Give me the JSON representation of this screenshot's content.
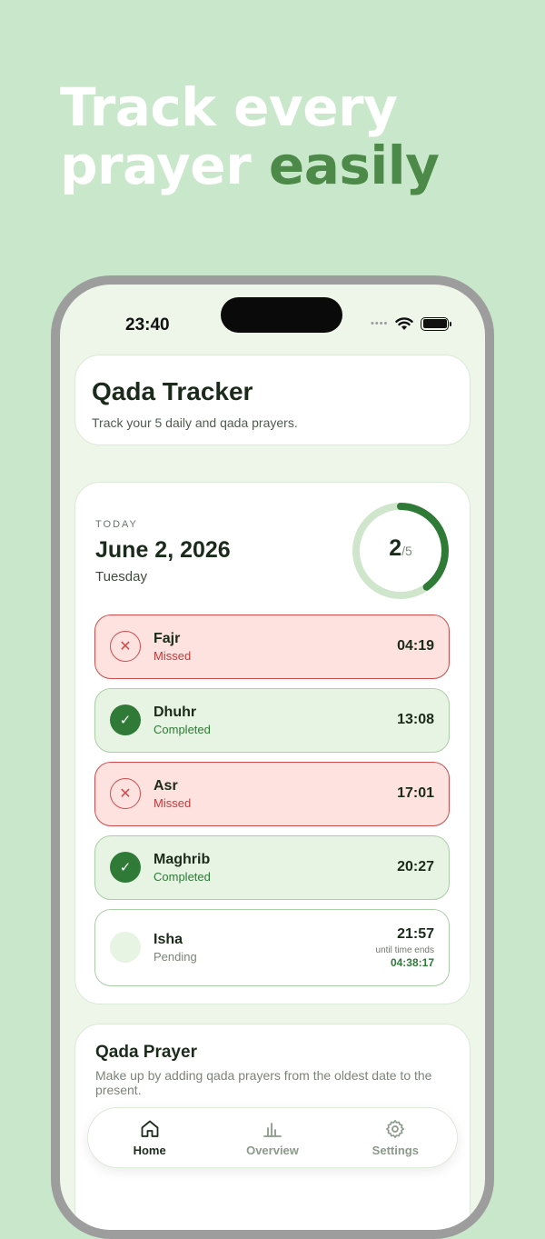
{
  "headline": {
    "line1": "Track every",
    "line2_plain": "prayer ",
    "line2_accent": "easily"
  },
  "status_bar": {
    "time": "23:40",
    "dots": "•••• ",
    "icons": [
      "wifi-icon",
      "battery-icon"
    ]
  },
  "header": {
    "title": "Qada Tracker",
    "subtitle": "Track your 5 daily and qada prayers."
  },
  "today": {
    "label": "TODAY",
    "date": "June 2, 2026",
    "weekday": "Tuesday",
    "progress": {
      "completed": "2",
      "total": "/5",
      "fraction": 0.4
    }
  },
  "prayers": [
    {
      "name": "Fajr",
      "status": "Missed",
      "time": "04:19",
      "state": "missed"
    },
    {
      "name": "Dhuhr",
      "status": "Completed",
      "time": "13:08",
      "state": "completed"
    },
    {
      "name": "Asr",
      "status": "Missed",
      "time": "17:01",
      "state": "missed"
    },
    {
      "name": "Maghrib",
      "status": "Completed",
      "time": "20:27",
      "state": "completed"
    },
    {
      "name": "Isha",
      "status": "Pending",
      "time": "21:57",
      "state": "pending",
      "until_label": "until time ends",
      "countdown": "04:38:17"
    }
  ],
  "qada": {
    "title": "Qada Prayer",
    "description": "Make up by adding qada prayers from the oldest date to the present."
  },
  "tabs": [
    {
      "label": "Home",
      "icon": "home-icon",
      "active": true
    },
    {
      "label": "Overview",
      "icon": "bar-chart-icon",
      "active": false
    },
    {
      "label": "Settings",
      "icon": "gear-icon",
      "active": false
    }
  ],
  "colors": {
    "background": "#c9e7ca",
    "accent_green": "#2f7a37",
    "headline_accent": "#4d8a4a",
    "missed_red": "#cf4b4b",
    "missed_bg": "#fde2e0",
    "completed_bg": "#e7f3e3"
  }
}
